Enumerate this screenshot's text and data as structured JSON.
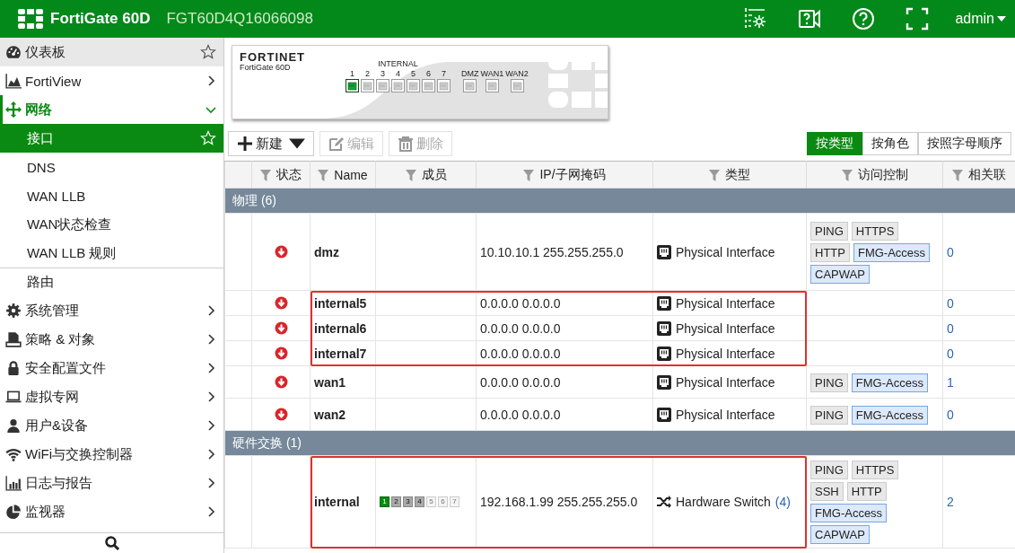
{
  "header": {
    "product": "FortiGate 60D",
    "serial": "FGT60D4Q16066098",
    "user": "admin"
  },
  "sidebar": {
    "items": [
      {
        "label": "仪表板",
        "kind": "pinned",
        "selected": false
      },
      {
        "label": "FortiView",
        "kind": "menu",
        "expanded": false,
        "selected": false
      },
      {
        "label": "网络",
        "kind": "menu",
        "expanded": true,
        "selected": false,
        "children": [
          {
            "label": "接口",
            "kind": "pinned",
            "selected": true
          },
          {
            "label": "DNS",
            "kind": "plain",
            "selected": false
          },
          {
            "label": "WAN LLB",
            "kind": "plain",
            "selected": false
          },
          {
            "label": "WAN状态检查",
            "kind": "plain",
            "selected": false
          },
          {
            "label": "WAN LLB 规则",
            "kind": "plain",
            "selected": false
          },
          {
            "label": "路由",
            "kind": "plain",
            "selected": false
          }
        ]
      },
      {
        "label": "系统管理",
        "kind": "menu",
        "expanded": false,
        "selected": false
      },
      {
        "label": "策略 & 对象",
        "kind": "menu",
        "expanded": false,
        "selected": false
      },
      {
        "label": "安全配置文件",
        "kind": "menu",
        "expanded": false,
        "selected": false
      },
      {
        "label": "虚拟专网",
        "kind": "menu",
        "expanded": false,
        "selected": false
      },
      {
        "label": "用户&设备",
        "kind": "menu",
        "expanded": false,
        "selected": false
      },
      {
        "label": "WiFi与交换控制器",
        "kind": "menu",
        "expanded": false,
        "selected": false
      },
      {
        "label": "日志与报告",
        "kind": "menu",
        "expanded": false,
        "selected": false
      },
      {
        "label": "监视器",
        "kind": "menu",
        "expanded": false,
        "selected": false
      }
    ]
  },
  "device": {
    "brand": "FORTINET",
    "model": "FortiGate 60D",
    "port_groups": [
      {
        "label": "INTERNAL",
        "ports": [
          {
            "label": "1",
            "link": true
          },
          {
            "label": "2",
            "link": false
          },
          {
            "label": "3",
            "link": false
          },
          {
            "label": "4",
            "link": false
          },
          {
            "label": "5",
            "link": false
          },
          {
            "label": "6",
            "link": false
          },
          {
            "label": "7",
            "link": false
          }
        ]
      },
      {
        "ports": [
          {
            "label": "DMZ",
            "link": false
          },
          {
            "label": "WAN1",
            "link": false
          },
          {
            "label": "WAN2",
            "link": false
          }
        ]
      }
    ]
  },
  "toolbar": {
    "actions": [
      {
        "label": "新建",
        "disabled": false,
        "dropdown": true
      },
      {
        "label": "编辑",
        "disabled": true,
        "dropdown": false
      },
      {
        "label": "删除",
        "disabled": true,
        "dropdown": false
      }
    ],
    "views": [
      {
        "label": "按类型",
        "selected": true
      },
      {
        "label": "按角色",
        "selected": false
      },
      {
        "label": "按照字母顺序",
        "selected": false
      }
    ]
  },
  "table": {
    "columns": [
      {
        "label": "状态"
      },
      {
        "label": "Name"
      },
      {
        "label": "成员"
      },
      {
        "label": "IP/子网掩码"
      },
      {
        "label": "类型"
      },
      {
        "label": "访问控制"
      },
      {
        "label": "相关联"
      }
    ],
    "groups": [
      {
        "label": "物理 (6)",
        "rows": [
          {
            "link_up": false,
            "name": "dmz",
            "outlined": false,
            "ip": "10.10.10.1 255.255.255.0",
            "type": {
              "kind": "physical",
              "label": "Physical Interface"
            },
            "access": [
              {
                "label": "PING",
                "highlighted": false
              },
              {
                "label": "HTTPS",
                "highlighted": false
              },
              {
                "label": "HTTP",
                "highlighted": false
              },
              {
                "label": "FMG-Access",
                "highlighted": true
              },
              {
                "label": "CAPWAP",
                "highlighted": true
              }
            ],
            "refs": "0"
          },
          {
            "link_up": false,
            "name": "internal5",
            "outlined": true,
            "ip": "0.0.0.0 0.0.0.0",
            "type": {
              "kind": "physical",
              "label": "Physical Interface"
            },
            "refs": "0"
          },
          {
            "link_up": false,
            "name": "internal6",
            "outlined": true,
            "ip": "0.0.0.0 0.0.0.0",
            "type": {
              "kind": "physical",
              "label": "Physical Interface"
            },
            "refs": "0"
          },
          {
            "link_up": false,
            "name": "internal7",
            "outlined": true,
            "ip": "0.0.0.0 0.0.0.0",
            "type": {
              "kind": "physical",
              "label": "Physical Interface"
            },
            "refs": "0"
          },
          {
            "link_up": false,
            "name": "wan1",
            "outlined": false,
            "ip": "0.0.0.0 0.0.0.0",
            "type": {
              "kind": "physical",
              "label": "Physical Interface"
            },
            "access": [
              {
                "label": "PING",
                "highlighted": false
              },
              {
                "label": "FMG-Access",
                "highlighted": true
              }
            ],
            "refs": "1"
          },
          {
            "link_up": false,
            "name": "wan2",
            "outlined": false,
            "ip": "0.0.0.0 0.0.0.0",
            "type": {
              "kind": "physical",
              "label": "Physical Interface"
            },
            "access": [
              {
                "label": "PING",
                "highlighted": false
              },
              {
                "label": "FMG-Access",
                "highlighted": true
              }
            ],
            "refs": "0"
          }
        ]
      },
      {
        "label": "硬件交换 (1)",
        "rows": [
          {
            "name": "internal",
            "outlined": true,
            "members": [
              {
                "label": "1",
                "member": true,
                "link_up": true
              },
              {
                "label": "2",
                "member": true,
                "link_up": false
              },
              {
                "label": "3",
                "member": true,
                "link_up": false
              },
              {
                "label": "4",
                "member": true,
                "link_up": false
              },
              {
                "label": "5",
                "member": false
              },
              {
                "label": "6",
                "member": false
              },
              {
                "label": "7",
                "member": false
              }
            ],
            "ip": "192.168.1.99 255.255.255.0",
            "type": {
              "kind": "switch",
              "label": "Hardware Switch",
              "count": "(4)"
            },
            "access": [
              {
                "label": "PING",
                "highlighted": false
              },
              {
                "label": "HTTPS",
                "highlighted": false
              },
              {
                "label": "SSH",
                "highlighted": false
              },
              {
                "label": "HTTP",
                "highlighted": false
              },
              {
                "label": "FMG-Access",
                "highlighted": true
              },
              {
                "label": "CAPWAP",
                "highlighted": true
              }
            ],
            "refs": "2"
          }
        ]
      }
    ]
  }
}
